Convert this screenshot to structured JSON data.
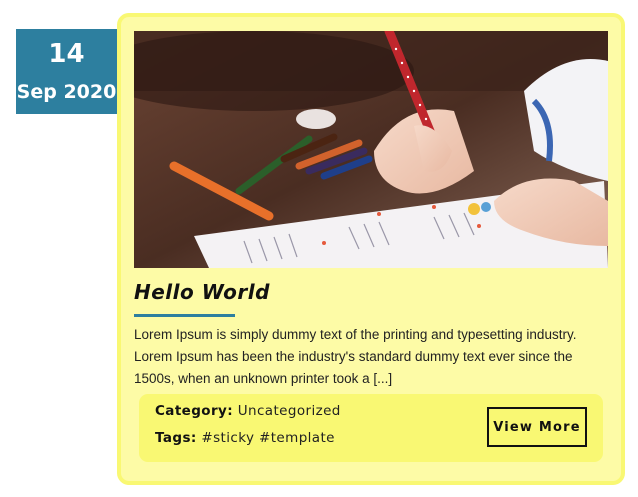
{
  "post": {
    "date": {
      "day": "14",
      "month_year": "Sep 2020"
    },
    "title": "Hello World",
    "excerpt": "Lorem Ipsum is simply dummy text of the printing and typesetting industry. Lorem Ipsum has been the industry's standard dummy text ever since the 1500s, when an unknown printer took a [...]",
    "category_label": "Category:",
    "category": "Uncategorized",
    "tags_label": "Tags:",
    "tags": [
      "#sticky",
      "#template"
    ],
    "view_more_label": "View More"
  },
  "colors": {
    "badge": "#2d7f9f",
    "card_background": "#fdfba6",
    "card_border": "#f9f873",
    "meta_background": "#f9f873"
  }
}
